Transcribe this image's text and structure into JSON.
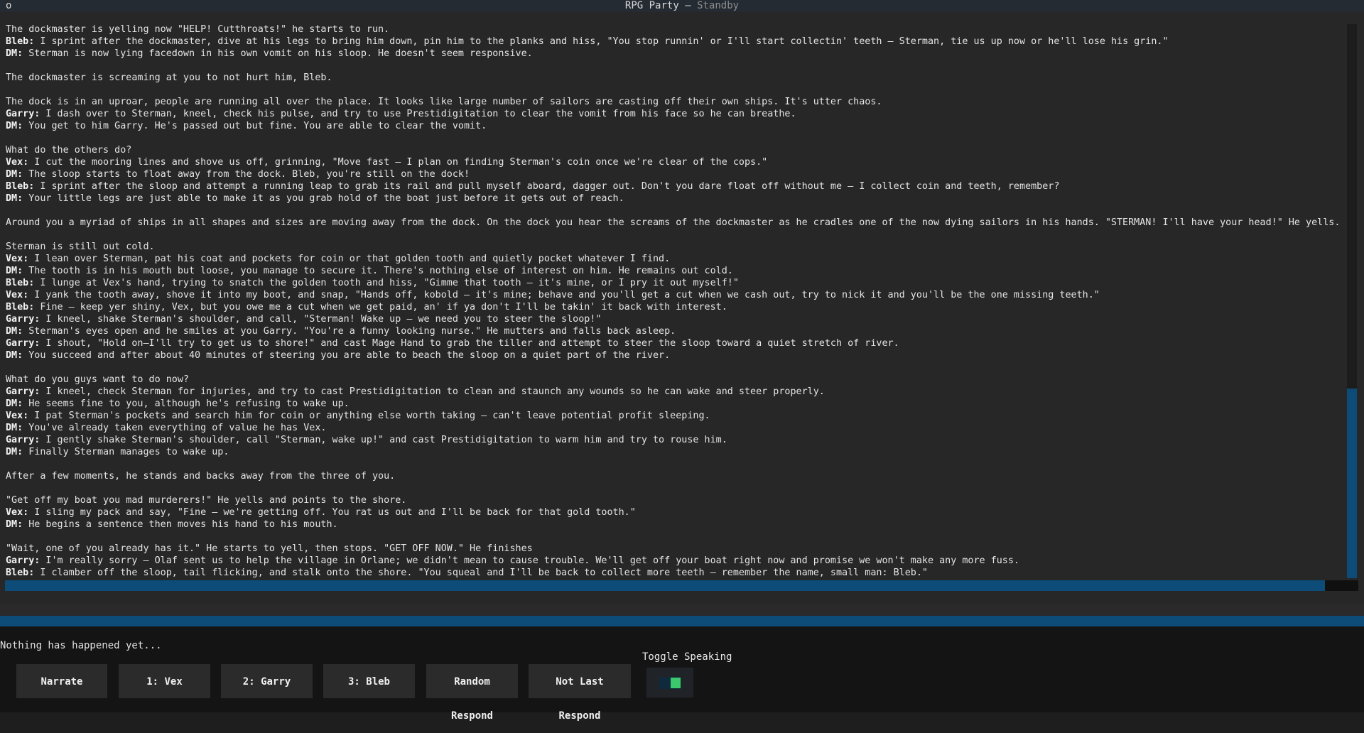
{
  "window": {
    "icon_glyph": "o",
    "title": "RPG Party –",
    "state": "Standby"
  },
  "log": [
    {
      "speaker": "",
      "text": "The dockmaster is yelling now \"HELP! Cutthroats!\" he starts to run."
    },
    {
      "speaker": "Bleb:",
      "text": " I sprint after the dockmaster, dive at his legs to bring him down, pin him to the planks and hiss, \"You stop runnin' or I'll start collectin' teeth – Sterman, tie us up now or he'll lose his grin.\""
    },
    {
      "speaker": "DM:",
      "text": " Sterman is now lying facedown in his own vomit on his sloop. He doesn't seem responsive."
    },
    {
      "speaker": "",
      "text": ""
    },
    {
      "speaker": "",
      "text": "The dockmaster is screaming at you to not hurt him, Bleb."
    },
    {
      "speaker": "",
      "text": ""
    },
    {
      "speaker": "",
      "text": "The dock is in an uproar, people are running all over the place. It looks like large number of sailors are casting off their own ships. It's utter chaos."
    },
    {
      "speaker": "Garry:",
      "text": " I dash over to Sterman, kneel, check his pulse, and try to use Prestidigitation to clear the vomit from his face so he can breathe."
    },
    {
      "speaker": "DM:",
      "text": " You get to him Garry. He's passed out but fine. You are able to clear the vomit."
    },
    {
      "speaker": "",
      "text": ""
    },
    {
      "speaker": "",
      "text": "What do the others do?"
    },
    {
      "speaker": "Vex:",
      "text": " I cut the mooring lines and shove us off, grinning, \"Move fast – I plan on finding Sterman's coin once we're clear of the cops.\""
    },
    {
      "speaker": "DM:",
      "text": " The sloop starts to float away from the dock. Bleb, you're still on the dock!"
    },
    {
      "speaker": "Bleb:",
      "text": " I sprint after the sloop and attempt a running leap to grab its rail and pull myself aboard, dagger out. Don't you dare float off without me – I collect coin and teeth, remember?"
    },
    {
      "speaker": "DM:",
      "text": " Your little legs are just able to make it as you grab hold of the boat just before it gets out of reach."
    },
    {
      "speaker": "",
      "text": ""
    },
    {
      "speaker": "",
      "text": "Around you a myriad of ships in all shapes and sizes are moving away from the dock. On the dock you hear the screams of the dockmaster as he cradles one of the now dying sailors in his hands. \"STERMAN! I'll have your head!\" He yells."
    },
    {
      "speaker": "",
      "text": ""
    },
    {
      "speaker": "",
      "text": "Sterman is still out cold."
    },
    {
      "speaker": "Vex:",
      "text": " I lean over Sterman, pat his coat and pockets for coin or that golden tooth and quietly pocket whatever I find."
    },
    {
      "speaker": "DM:",
      "text": " The tooth is in his mouth but loose, you manage to secure it. There's nothing else of interest on him. He remains out cold."
    },
    {
      "speaker": "Bleb:",
      "text": " I lunge at Vex's hand, trying to snatch the golden tooth and hiss, \"Gimme that tooth – it's mine, or I pry it out myself!\""
    },
    {
      "speaker": "Vex:",
      "text": " I yank the tooth away, shove it into my boot, and snap, \"Hands off, kobold – it's mine; behave and you'll get a cut when we cash out, try to nick it and you'll be the one missing teeth.\""
    },
    {
      "speaker": "Bleb:",
      "text": " Fine – keep yer shiny, Vex, but you owe me a cut when we get paid, an' if ya don't I'll be takin' it back with interest."
    },
    {
      "speaker": "Garry:",
      "text": " I kneel, shake Sterman's shoulder, and call, \"Sterman! Wake up – we need you to steer the sloop!\""
    },
    {
      "speaker": "DM:",
      "text": " Sterman's eyes open and he smiles at you Garry. \"You're a funny looking nurse.\" He mutters and falls back asleep."
    },
    {
      "speaker": "Garry:",
      "text": " I shout, \"Hold on—I'll try to get us to shore!\" and cast Mage Hand to grab the tiller and attempt to steer the sloop toward a quiet stretch of river."
    },
    {
      "speaker": "DM:",
      "text": " You succeed and after about 40 minutes of steering you are able to beach the sloop on a quiet part of the river."
    },
    {
      "speaker": "",
      "text": ""
    },
    {
      "speaker": "",
      "text": "What do you guys want to do now?"
    },
    {
      "speaker": "Garry:",
      "text": " I kneel, check Sterman for injuries, and try to cast Prestidigitation to clean and staunch any wounds so he can wake and steer properly."
    },
    {
      "speaker": "DM:",
      "text": " He seems fine to you, although he's refusing to wake up."
    },
    {
      "speaker": "Vex:",
      "text": " I pat Sterman's pockets and search him for coin or anything else worth taking – can't leave potential profit sleeping."
    },
    {
      "speaker": "DM:",
      "text": " You've already taken everything of value he has Vex."
    },
    {
      "speaker": "Garry:",
      "text": " I gently shake Sterman's shoulder, call \"Sterman, wake up!\" and cast Prestidigitation to warm him and try to rouse him."
    },
    {
      "speaker": "DM:",
      "text": " Finally Sterman manages to wake up."
    },
    {
      "speaker": "",
      "text": ""
    },
    {
      "speaker": "",
      "text": "After a few moments, he stands and backs away from the three of you."
    },
    {
      "speaker": "",
      "text": ""
    },
    {
      "speaker": "",
      "text": "\"Get off my boat you mad murderers!\" He yells and points to the shore."
    },
    {
      "speaker": "Vex:",
      "text": " I sling my pack and say, \"Fine – we're getting off. You rat us out and I'll be back for that gold tooth.\""
    },
    {
      "speaker": "DM:",
      "text": " He begins a sentence then moves his hand to his mouth."
    },
    {
      "speaker": "",
      "text": ""
    },
    {
      "speaker": "",
      "text": "\"Wait, one of you already has it.\" He starts to yell, then stops. \"GET OFF NOW.\" He finishes"
    },
    {
      "speaker": "Garry:",
      "text": " I'm really sorry – Olaf sent us to help the village in Orlane; we didn't mean to cause trouble. We'll get off your boat right now and promise we won't make any more fuss."
    },
    {
      "speaker": "Bleb:",
      "text": " I clamber off the sloop, tail flicking, and stalk onto the shore. \"You squeal and I'll be back to collect more teeth – remember the name, small man: Bleb.\""
    }
  ],
  "status_text": "Nothing has happened yet...",
  "buttons": [
    {
      "id": "narrate",
      "label": "Narrate"
    },
    {
      "id": "vex",
      "label": "1: Vex"
    },
    {
      "id": "garry",
      "label": "2: Garry"
    },
    {
      "id": "bleb",
      "label": "3: Bleb"
    },
    {
      "id": "random-respond",
      "label": "Random Respond"
    },
    {
      "id": "not-last-respond",
      "label": "Not Last Respond"
    }
  ],
  "toggle": {
    "label": "Toggle Speaking",
    "on": true
  }
}
